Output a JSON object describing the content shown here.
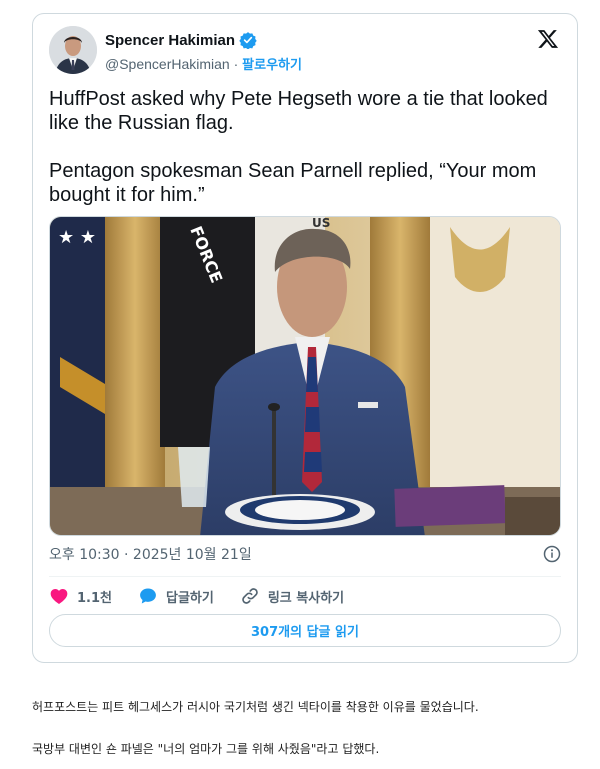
{
  "tweet": {
    "author": {
      "display_name": "Spencer Hakimian",
      "handle": "@SpencerHakimian",
      "separator": " · ",
      "follow_label": "팔로우하기",
      "verified_icon": "verified-badge-icon"
    },
    "text": "HuffPost asked why Pete Hegseth wore a tie that looked like the Russian flag.\n\nPentagon spokesman Sean Parnell replied, “Your mom bought it for him.”",
    "timestamp": "오후 10:30 · 2025년 10월 21일",
    "likes_count": "1.1천",
    "reply_label": "답글하기",
    "copy_link_label": "링크 복사하기",
    "read_replies_label": "307개의 답글 읽기",
    "colors": {
      "accent": "#1d9bf0",
      "like": "#f91880",
      "text": "#0f1419",
      "secondary": "#536471"
    }
  },
  "media": {
    "flag_text": "FORCE",
    "flag_text_2": "US"
  },
  "captions": [
    "허프포스트는 피트 헤그세스가 러시아 국기처럼 생긴 넥타이를 착용한 이유를 물었습니다.",
    "국방부 대변인 숀 파넬은 \"너의 엄마가 그를 위해 사줬음\"라고 답했다."
  ]
}
